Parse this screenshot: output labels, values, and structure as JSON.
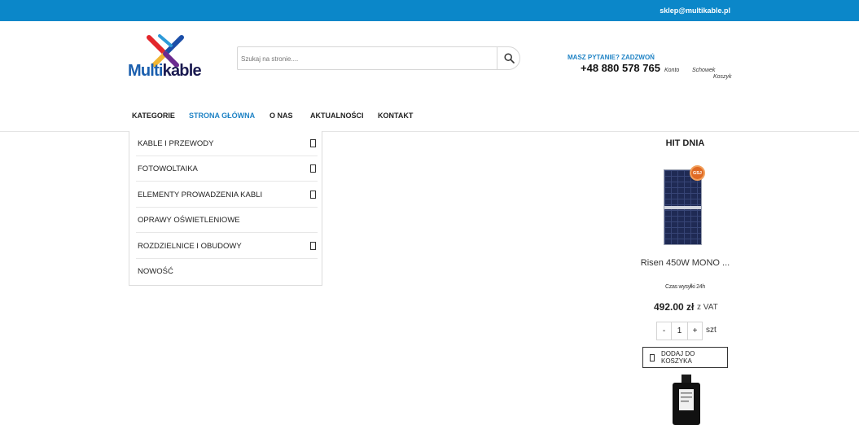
{
  "topbar": {
    "email": "sklep@multikable.pl"
  },
  "logo": {
    "part1": "Multi",
    "part2": "kable"
  },
  "search": {
    "placeholder": "Szukaj na stronie...."
  },
  "contact": {
    "question": "MASZ PYTANIE? ZADZWOŃ",
    "phone": "+48 880 578 765"
  },
  "account": {
    "konto": "Konto",
    "schowek": "Schowek",
    "koszyk": "Koszyk"
  },
  "nav": [
    "KATEGORIE",
    "STRONA GŁÓWNA",
    "O NAS",
    "AKTUALNOŚCI",
    "KONTAKT"
  ],
  "categories": [
    {
      "label": "KABLE I PRZEWODY",
      "has_children": true
    },
    {
      "label": "FOTOWOLTAIKA",
      "has_children": true
    },
    {
      "label": "ELEMENTY PROWADZENIA KABLI",
      "has_children": true
    },
    {
      "label": "OPRAWY OŚWIETLENIOWE",
      "has_children": false
    },
    {
      "label": "ROZDZIELNICE I OBUDOWY",
      "has_children": true
    },
    {
      "label": "NOWOŚĆ",
      "has_children": false
    }
  ],
  "hit": {
    "title": "HIT DNIA",
    "badge": "GSJ",
    "product_name": "Risen 450W MONO ...",
    "shipping": "Czas wysyłki 24h",
    "price": "492.00 zł",
    "vat": "z VAT",
    "qty_minus": "-",
    "qty_value": "1",
    "qty_plus": "+",
    "unit": "szt",
    "add_to_cart": "DODAJ DO KOSZYKA"
  },
  "colors": {
    "accent": "#0b87c9",
    "nav_active": "#1f83c5"
  }
}
